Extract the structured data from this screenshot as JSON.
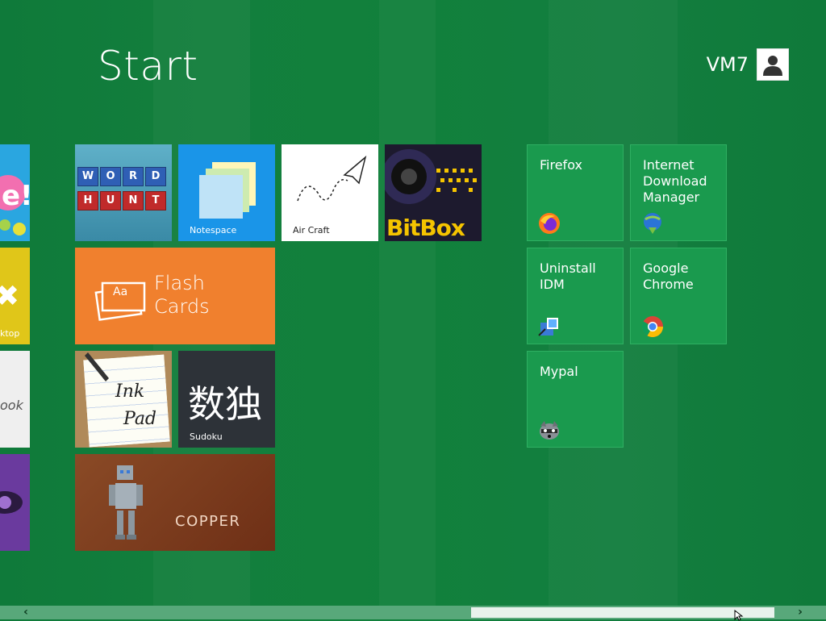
{
  "header": {
    "title": "Start",
    "user_name": "VM7"
  },
  "tiles": {
    "word_hunt": {
      "letters_row1": [
        "W",
        "O",
        "R",
        "D"
      ],
      "letters_row2": [
        "H",
        "U",
        "N",
        "T"
      ]
    },
    "notespace": {
      "label": "Notespace"
    },
    "air_craft": {
      "label": "Air Craft"
    },
    "bitbox": {
      "label": "BitBox"
    },
    "flash_cards": {
      "line1": "Flash",
      "line2": "Cards",
      "icon_text": "Aa"
    },
    "ink_pad": {
      "line1": "Ink",
      "line2": "Pad"
    },
    "sudoku": {
      "chars": "数独",
      "label": "Sudoku"
    },
    "copper": {
      "label": "COPPER"
    },
    "edge_tiles": {
      "left_label_1": "ktop",
      "left_label_2": "ook"
    }
  },
  "desktop_tiles": [
    {
      "label": "Firefox",
      "icon": "firefox-icon"
    },
    {
      "label": "Internet Download Manager",
      "icon": "idm-icon"
    },
    {
      "label": "Uninstall IDM",
      "icon": "uninstall-icon"
    },
    {
      "label": "Google Chrome",
      "icon": "chrome-icon"
    },
    {
      "label": "Mypal",
      "icon": "mypal-icon"
    }
  ],
  "scrollbar": {
    "left_arrow": "‹",
    "right_arrow": "›",
    "position_fraction": 0.57
  },
  "colors": {
    "background": "#117e3c",
    "desktop_tile": "#1a9a4e",
    "notespace": "#1a95e8",
    "flash_cards": "#f0802e",
    "copper": "#7a3a1c",
    "sudoku": "#2d3238"
  }
}
